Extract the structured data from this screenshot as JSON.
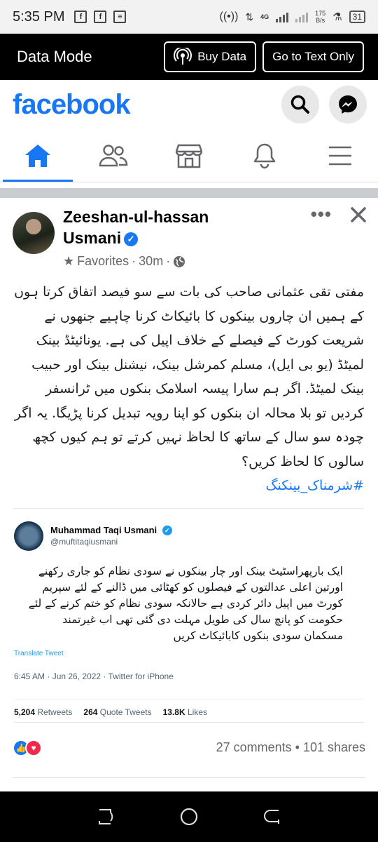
{
  "status_bar": {
    "time": "5:35 PM",
    "network": "4G",
    "speed_value": "175",
    "speed_unit": "B/s",
    "battery": "31"
  },
  "data_bar": {
    "title": "Data Mode",
    "buy_data_label": "Buy Data",
    "text_only_label": "Go to Text Only"
  },
  "header": {
    "logo": "facebook"
  },
  "post": {
    "author_line1": "Zeeshan-ul-hassan",
    "author_line2": "Usmani",
    "audience": "Favorites",
    "time": "30m",
    "text": "مفتی تقی عثمانی صاحب کی بات سے سو فیصد اتفاق کرتا ہوں کے ہمیں ان چاروں بینکوں کا بائیکاٹ کرنا چاہیے جنھوں نے شریعت کورٹ کے فیصلے کے خلاف اپیل کی ہے. یونائیٹڈ بینک لمیٹڈ (یو بی ایل)، مسلم کمرشل بینک، نیشنل بینک اور حبیب بینک لمیٹڈ. اگر ہم سارا پیسہ اسلامک بنکوں میں ٹرانسفر کردیں تو بلا محالہ ان بنکوں کو اپنا رویہ تبدیل کرنا پڑیگا. یہ اگر چودہ سو سال کے ساتھ کا لحاظ نہیں کرتے تو ہم کیوں کچھ سالوں کا لحاظ کریں؟",
    "hashtag": "#شرمناک_بینکنگ"
  },
  "tweet": {
    "name": "Muhammad Taqi Usmani",
    "handle": "@muftitaqiusmani",
    "text": "ایک بارپھراسٹیٹ بینک اور چار بینکوں نے سودی نظام کو جاری رکھنے اورتین اعلی عدالتوں کے فیصلوں کو کھٹائی میں ڈالنے کے لئے سپریم کورٹ میں اپیل دائر کردی ہے حالانکہ سودی نظام کو ختم کرنے کے لئے حکومت کو پانچ سال کی طویل مہلت دی گئی تھی اب غیرتمند مسکمان سودی بنکوں کابائیکاٹ کریں",
    "translate": "Translate Tweet",
    "date": "6:45 AM · Jun 26, 2022 · Twitter for iPhone",
    "retweets_count": "5,204",
    "retweets_label": "Retweets",
    "quotes_count": "264",
    "quotes_label": "Quote Tweets",
    "likes_count": "13.8K",
    "likes_label": "Likes"
  },
  "engagement": {
    "comments": "27 comments",
    "shares": "101 shares"
  },
  "colors": {
    "brand": "#1877f2",
    "love": "#f02849"
  }
}
